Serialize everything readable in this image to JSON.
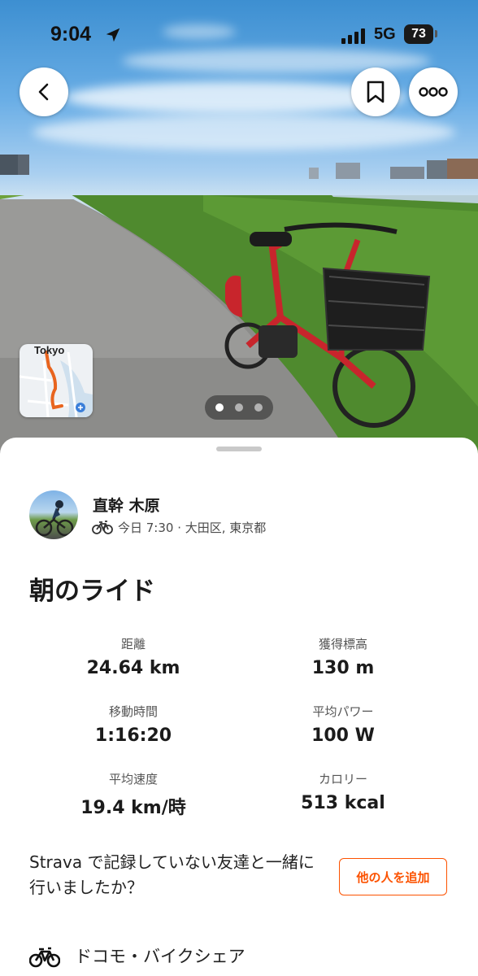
{
  "status_bar": {
    "time": "9:04",
    "network": "5G",
    "battery": "73"
  },
  "icons": {
    "back": "chevron-left-icon",
    "bookmark": "bookmark-icon",
    "more": "more-horizontal-icon",
    "location": "location-arrow-icon",
    "signal": "cellular-signal-icon",
    "sport": "bicycle-icon"
  },
  "map_thumbnail": {
    "label": "Tokyo"
  },
  "carousel": {
    "total": 3,
    "active_index": 0
  },
  "athlete": {
    "name": "直幹 木原",
    "meta": "今日 7:30 · 大田区, 東京都"
  },
  "activity": {
    "title": "朝のライド",
    "stats": [
      {
        "label": "距離",
        "value": "24.64 km"
      },
      {
        "label": "獲得標高",
        "value": "130 m"
      },
      {
        "label": "移動時間",
        "value": "1:16:20"
      },
      {
        "label": "平均パワー",
        "value": "100 W"
      },
      {
        "label": "平均速度",
        "value": "19.4 km/時"
      },
      {
        "label": "カロリー",
        "value": "513 kcal"
      }
    ]
  },
  "tag_friends": {
    "prompt": "Strava で記録していない友達と一緒に行いましたか？",
    "button_label": "他の人を追加"
  },
  "gear": {
    "name": "ドコモ・バイクシェア"
  },
  "colors": {
    "accent": "#fc5200",
    "route": "#e8641e"
  }
}
